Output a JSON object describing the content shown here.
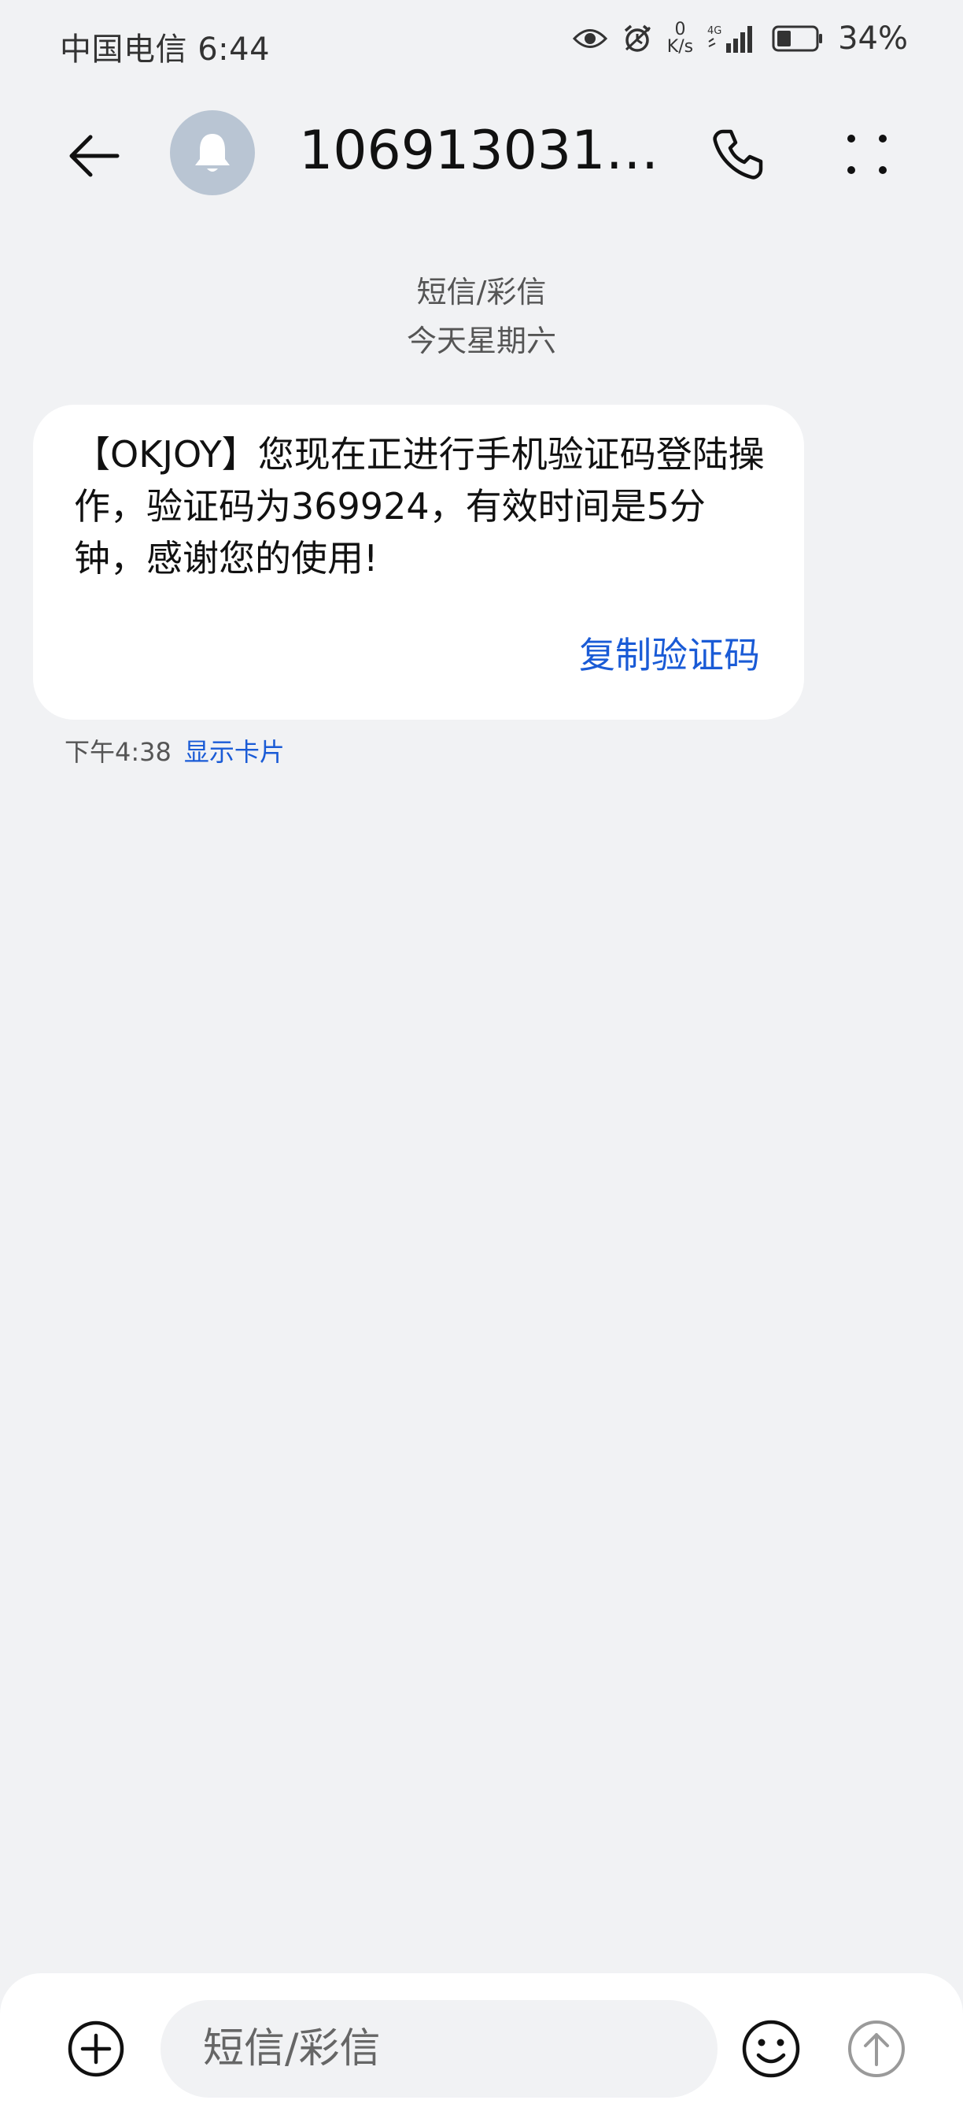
{
  "status_bar": {
    "carrier_time": "中国电信 6:44",
    "net_speed_value": "0",
    "net_speed_unit": "K/s",
    "network": "4G",
    "battery": "34%",
    "icons": [
      "eye-icon",
      "alarm-icon",
      "signal-icon",
      "battery-icon"
    ]
  },
  "header": {
    "contact": "1069130316…",
    "icons": [
      "back-arrow-icon",
      "bell-icon",
      "phone-icon",
      "more-icon"
    ]
  },
  "conversation": {
    "type": "短信/彩信",
    "date": "今天星期六"
  },
  "message": {
    "text": "【OKJOY】您现在正进行手机验证码登陆操作，验证码为369924，有效时间是5分钟，感谢您的使用!",
    "action": "复制验证码",
    "time": "下午4:38",
    "show_card": "显示卡片"
  },
  "input_bar": {
    "placeholder": "短信/彩信",
    "icons": [
      "plus-icon",
      "emoji-icon",
      "send-arrow-icon"
    ]
  },
  "colors": {
    "background": "#f1f2f4",
    "bubble": "#ffffff",
    "link": "#1a5bd6",
    "avatar": "#b9c5d3"
  }
}
